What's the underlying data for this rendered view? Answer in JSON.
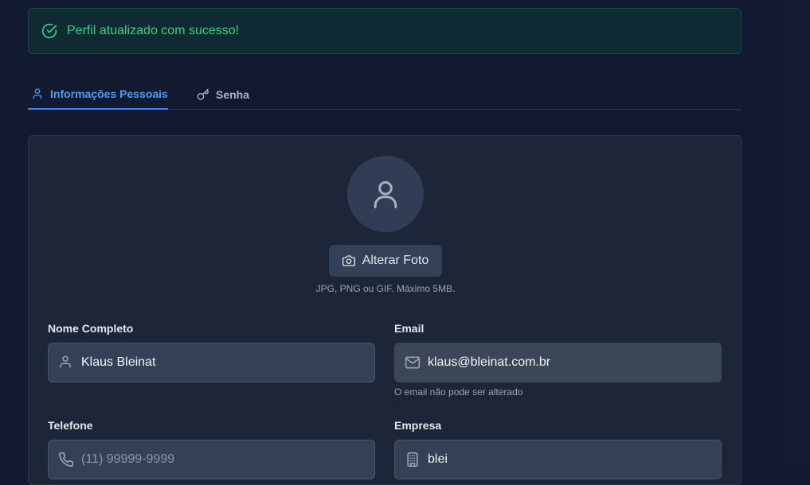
{
  "alert": {
    "message": "Perfil atualizado com sucesso!",
    "icon": "check-circle-icon",
    "color": "#34d37f"
  },
  "tabs": [
    {
      "label": "Informações Pessoais",
      "icon": "user-icon",
      "active": true
    },
    {
      "label": "Senha",
      "icon": "key-icon",
      "active": false
    }
  ],
  "profile": {
    "avatar_icon": "user-icon",
    "change_photo_label": "Alterar Foto",
    "change_photo_icon": "camera-icon",
    "photo_hint": "JPG, PNG ou GIF. Máximo 5MB."
  },
  "form": {
    "name": {
      "label": "Nome Completo",
      "value": "Klaus Bleinat",
      "icon": "user-icon"
    },
    "email": {
      "label": "Email",
      "value": "klaus@bleinat.com.br",
      "icon": "mail-icon",
      "help": "O email não pode ser alterado"
    },
    "phone": {
      "label": "Telefone",
      "value": "",
      "placeholder": "(11) 99999-9999",
      "icon": "phone-icon"
    },
    "company": {
      "label": "Empresa",
      "value": "blei",
      "icon": "building-icon"
    }
  },
  "colors": {
    "accent": "#3b82f6",
    "success": "#34d37f",
    "background": "#111a2e",
    "card": "#1d2639"
  }
}
